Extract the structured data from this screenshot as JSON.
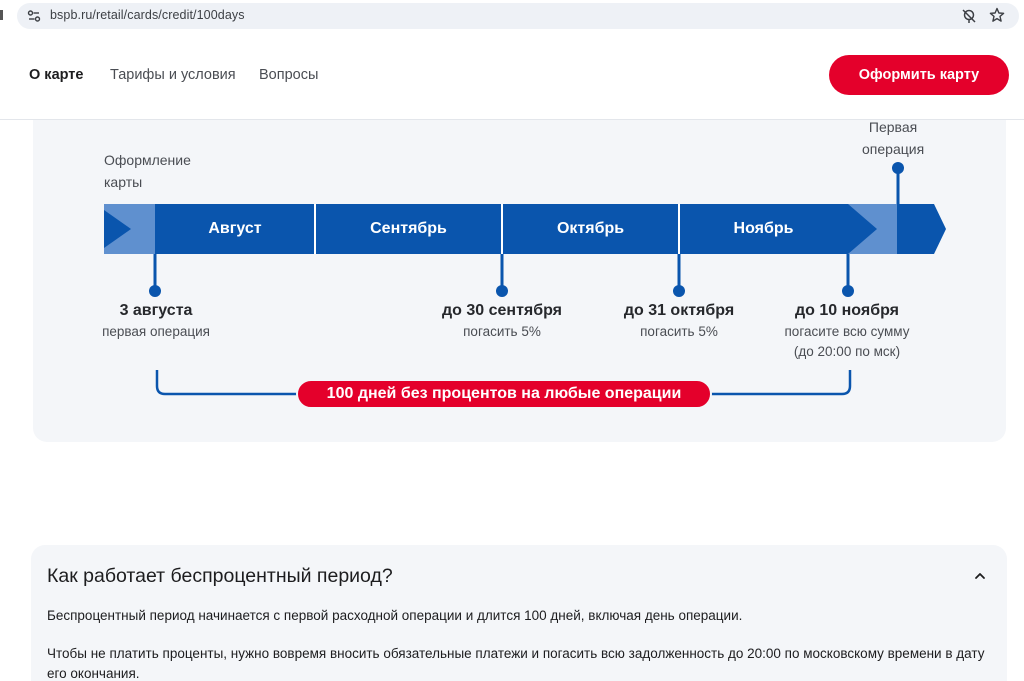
{
  "browser": {
    "url": "bspb.ru/retail/cards/credit/100days",
    "icons": [
      "site-settings-icon",
      "tracking-blocked-icon",
      "star-bookmark-icon"
    ]
  },
  "header": {
    "nav": [
      {
        "label": "О карте",
        "active": true
      },
      {
        "label": "Тарифы и условия",
        "active": false
      },
      {
        "label": "Вопросы",
        "active": false
      }
    ],
    "cta_label": "Оформить карту"
  },
  "timeline": {
    "start_label_line1": "Оформление",
    "start_label_line2": "карты",
    "end_label_line1": "Первая",
    "end_label_line2": "операция",
    "months": [
      "Август",
      "Сентябрь",
      "Октябрь",
      "Ноябрь"
    ],
    "milestones": [
      {
        "date": "3 августа",
        "note_line1": "первая операция",
        "note_line2": ""
      },
      {
        "date": "до 30 сентября",
        "note_line1": "погасить 5%",
        "note_line2": ""
      },
      {
        "date": "до 31 октября",
        "note_line1": "погасить 5%",
        "note_line2": ""
      },
      {
        "date": "до 10 ноября",
        "note_line1": "погасите всю сумму",
        "note_line2": "(до 20:00 по мск)"
      }
    ],
    "badge": "100 дней без процентов на любые операции"
  },
  "faq": {
    "question": "Как работает беспроцентный период?",
    "expanded": true,
    "paragraphs": [
      "Беспроцентный период начинается с первой расходной операции и длится 100 дней, включая день операции.",
      "Чтобы не платить проценты, нужно вовремя вносить обязательные платежи и погасить всю задолженность до 20:00 по московскому времени в дату его окончания."
    ]
  },
  "colors": {
    "brand_red": "#e4002b",
    "timeline_blue": "#0a55ad",
    "timeline_light_blue": "#5f90cf",
    "card_bg": "#f4f6f9"
  }
}
